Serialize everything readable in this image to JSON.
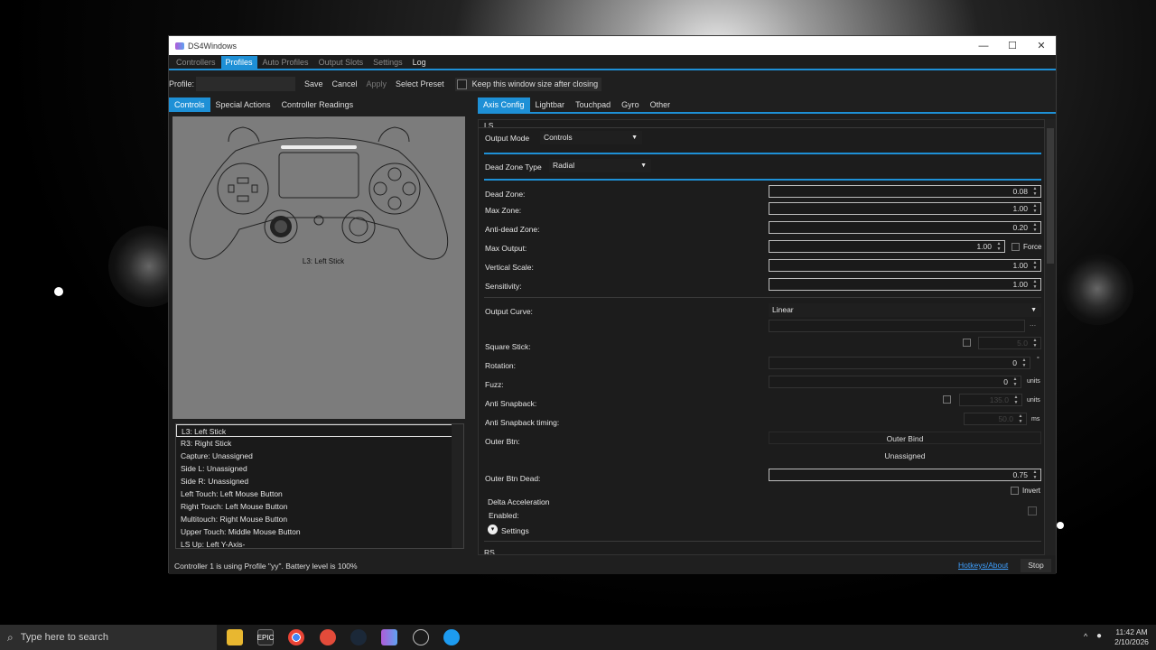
{
  "window": {
    "title": "DS4Windows",
    "minimize": "—",
    "maximize": "☐",
    "close": "✕"
  },
  "menu": [
    "Controllers",
    "Profiles",
    "Auto Profiles",
    "Output Slots",
    "Settings",
    "Log"
  ],
  "profile": {
    "label": "Profile:",
    "name_value": "",
    "save": "Save",
    "cancel": "Cancel",
    "apply": "Apply",
    "select_preset": "Select Preset",
    "keep_size": "Keep this window size after closing"
  },
  "left_tabs": [
    "Controls",
    "Special Actions",
    "Controller Readings"
  ],
  "controller_caption": "L3: Left Stick",
  "binding_list": [
    "L3: Left Stick",
    "R3: Right Stick",
    "Capture: Unassigned",
    "Side L: Unassigned",
    "Side R: Unassigned",
    "Left Touch: Left Mouse Button",
    "Right Touch: Left Mouse Button",
    "Multitouch: Right Mouse Button",
    "Upper Touch: Middle Mouse Button",
    "LS Up: Left Y-Axis-"
  ],
  "right_tabs": [
    "Axis Config",
    "Lightbar",
    "Touchpad",
    "Gyro",
    "Other"
  ],
  "axis": {
    "section_ls": "LS",
    "output_mode_label": "Output Mode",
    "output_mode_value": "Controls",
    "dead_zone_type_label": "Dead Zone Type",
    "dead_zone_type_value": "Radial",
    "dead_zone_label": "Dead Zone:",
    "dead_zone_value": "0.08",
    "max_zone_label": "Max Zone:",
    "max_zone_value": "1.00",
    "anti_dead_label": "Anti-dead Zone:",
    "anti_dead_value": "0.20",
    "max_output_label": "Max Output:",
    "max_output_value": "1.00",
    "force_label": "Force",
    "vertical_scale_label": "Vertical Scale:",
    "vertical_scale_value": "1.00",
    "sensitivity_label": "Sensitivity:",
    "sensitivity_value": "1.00",
    "output_curve_label": "Output Curve:",
    "output_curve_value": "Linear",
    "curve_more": "...",
    "square_stick_label": "Square Stick:",
    "square_stick_value": "5.0",
    "rotation_label": "Rotation:",
    "rotation_value": "0",
    "rotation_unit": "°",
    "fuzz_label": "Fuzz:",
    "fuzz_value": "0",
    "fuzz_unit": "units",
    "anti_snapback_label": "Anti Snapback:",
    "anti_snapback_value": "135.0",
    "anti_snapback_unit": "units",
    "anti_snapback_timing_label": "Anti Snapback timing:",
    "anti_snapback_timing_value": "50.0",
    "anti_snapback_timing_unit": "ms",
    "outer_btn_label": "Outer Btn:",
    "outer_bind_button": "Outer Bind",
    "outer_bind_value": "Unassigned",
    "outer_btn_dead_label": "Outer Btn Dead:",
    "outer_btn_dead_value": "0.75",
    "invert_label": "Invert",
    "delta_accel_label": "Delta Acceleration",
    "enabled_label": "Enabled:",
    "settings_label": "Settings",
    "section_rs": "RS"
  },
  "status": {
    "text": "Controller 1 is using Profile \"yy\". Battery level is 100%",
    "hotkeys": "Hotkeys/About",
    "stop": "Stop"
  },
  "taskbar": {
    "search_placeholder": "Type here to search",
    "time": "11:42 AM",
    "date": "2/10/2026"
  },
  "colors": {
    "accent": "#1e90d6",
    "window_bg": "#1f1f1f",
    "link": "#3fa0ff"
  }
}
